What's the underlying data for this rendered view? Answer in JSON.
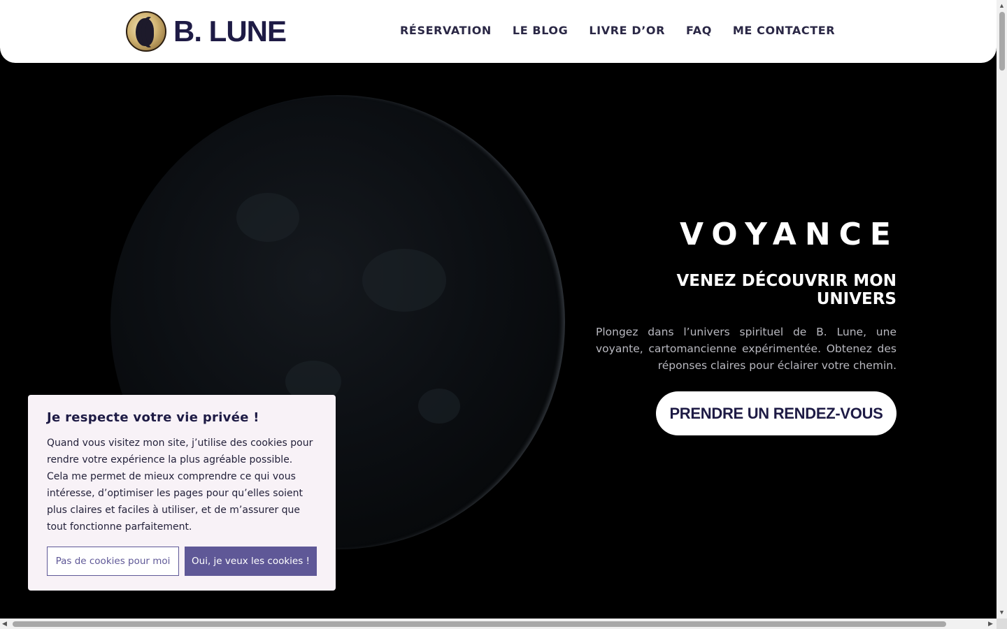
{
  "brand": {
    "name": "B. LUNE"
  },
  "nav": [
    {
      "label": "RÉSERVATION"
    },
    {
      "label": "LE BLOG"
    },
    {
      "label": "LIVRE D’OR"
    },
    {
      "label": "FAQ"
    },
    {
      "label": "ME CONTACTER"
    }
  ],
  "hero": {
    "title": "VOYANCE",
    "subtitle": "VENEZ DÉCOUVRIR MON UNIVERS",
    "description": "Plongez dans l’univers spirituel de B. Lune, une voyante, cartomancienne expérimentée. Obtenez des réponses claires pour éclairer votre chemin.",
    "cta_label": "PRENDRE UN RENDEZ-VOUS"
  },
  "cookie_banner": {
    "title": "Je respecte votre vie privée !",
    "body": "Quand vous visitez mon site, j’utilise des cookies pour rendre votre expérience la plus agréable possible. Cela me permet de mieux comprendre ce qui vous intéresse, d’optimiser les pages pour qu’elles soient plus claires et faciles à utiliser, et de m’assurer que tout fonctionne parfaitement.",
    "decline_label": "Pas de cookies pour moi",
    "accept_label": "Oui, je veux les cookies !"
  },
  "colors": {
    "brand_navy": "#1e1b45",
    "accent_purple": "#5f5897",
    "banner_bg": "#f8f2f7"
  }
}
